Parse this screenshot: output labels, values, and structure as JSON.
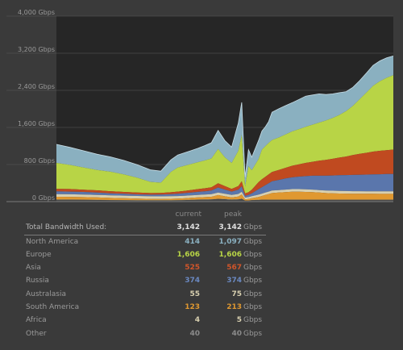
{
  "chart_data": {
    "type": "area",
    "stacked": true,
    "y_unit": "Gbps",
    "ylim": [
      0,
      4000
    ],
    "y_ticks": [
      "0 Gbps",
      "800 Gbps",
      "1,600 Gbps",
      "2,400 Gbps",
      "3,200 Gbps",
      "4,000 Gbps"
    ],
    "y_tick_values": [
      0,
      800,
      1600,
      2400,
      3200,
      4000
    ],
    "grid": true,
    "x": [
      0,
      4,
      8,
      12,
      16,
      20,
      24,
      28,
      31,
      34,
      36,
      38,
      40,
      42,
      44,
      46,
      48,
      50,
      52,
      54,
      55,
      56,
      57,
      58,
      60,
      61,
      62,
      63,
      64,
      66,
      68,
      70,
      72,
      74,
      76,
      78,
      80,
      82,
      84,
      86,
      88,
      90,
      92,
      94,
      96,
      98,
      100
    ],
    "series": [
      {
        "color": "#4a4a4a",
        "values": [
          40,
          40,
          38,
          35,
          30,
          28,
          26,
          24,
          25,
          26,
          28,
          32,
          36,
          40,
          42,
          45,
          55,
          50,
          40,
          45,
          60,
          20,
          22,
          30,
          35,
          38,
          38,
          40,
          40,
          40,
          40,
          40,
          40,
          40,
          40,
          40,
          40,
          40,
          40,
          40,
          40,
          40,
          40,
          40,
          40,
          40,
          40
        ]
      },
      {
        "color": "#c8c29c",
        "values": [
          5,
          5,
          5,
          5,
          5,
          5,
          5,
          5,
          5,
          5,
          5,
          5,
          5,
          5,
          5,
          5,
          5,
          5,
          5,
          5,
          5,
          2,
          3,
          3,
          4,
          4,
          4,
          4,
          4,
          4,
          4,
          4,
          4,
          4,
          4,
          4,
          4,
          4,
          4,
          4,
          4,
          4,
          4,
          4,
          4,
          4,
          4
        ]
      },
      {
        "color": "#e09830",
        "values": [
          60,
          58,
          55,
          50,
          45,
          40,
          35,
          30,
          28,
          30,
          32,
          35,
          40,
          45,
          50,
          55,
          80,
          60,
          45,
          60,
          90,
          25,
          30,
          40,
          60,
          80,
          100,
          120,
          140,
          150,
          160,
          170,
          170,
          165,
          160,
          150,
          140,
          135,
          130,
          128,
          126,
          125,
          124,
          124,
          123,
          123,
          123
        ]
      },
      {
        "color": "#d8d0b0",
        "values": [
          55,
          55,
          55,
          55,
          55,
          55,
          55,
          55,
          55,
          55,
          55,
          55,
          55,
          55,
          55,
          55,
          55,
          55,
          55,
          55,
          55,
          40,
          42,
          45,
          50,
          50,
          52,
          52,
          54,
          54,
          55,
          55,
          55,
          55,
          55,
          55,
          55,
          55,
          55,
          55,
          55,
          55,
          55,
          55,
          55,
          55,
          55
        ]
      },
      {
        "color": "#5a76ac",
        "values": [
          60,
          58,
          55,
          50,
          45,
          40,
          35,
          35,
          40,
          45,
          50,
          55,
          60,
          65,
          70,
          80,
          110,
          90,
          70,
          90,
          120,
          40,
          45,
          60,
          120,
          140,
          160,
          180,
          200,
          220,
          240,
          255,
          270,
          285,
          300,
          310,
          320,
          330,
          340,
          345,
          350,
          355,
          360,
          365,
          368,
          372,
          374
        ]
      },
      {
        "color": "#c04a20",
        "values": [
          55,
          55,
          50,
          48,
          45,
          40,
          38,
          35,
          35,
          40,
          45,
          50,
          55,
          60,
          65,
          70,
          90,
          75,
          60,
          80,
          110,
          50,
          60,
          80,
          150,
          170,
          180,
          190,
          200,
          215,
          230,
          250,
          265,
          285,
          300,
          325,
          340,
          360,
          380,
          400,
          430,
          450,
          470,
          490,
          505,
          515,
          525
        ]
      },
      {
        "color": "#b8d446",
        "values": [
          560,
          520,
          480,
          440,
          420,
          380,
          320,
          240,
          220,
          440,
          520,
          540,
          560,
          580,
          600,
          620,
          740,
          620,
          560,
          760,
          1000,
          150,
          560,
          420,
          500,
          640,
          660,
          680,
          690,
          700,
          720,
          740,
          760,
          780,
          800,
          820,
          850,
          880,
          920,
          980,
          1060,
          1180,
          1300,
          1420,
          1500,
          1560,
          1606
        ]
      },
      {
        "color": "#8ab0c0",
        "values": [
          400,
          380,
          360,
          340,
          320,
          300,
          280,
          260,
          250,
          260,
          270,
          280,
          290,
          300,
          320,
          340,
          400,
          360,
          340,
          600,
          700,
          200,
          360,
          280,
          400,
          400,
          420,
          460,
          600,
          620,
          620,
          620,
          640,
          660,
          640,
          620,
          560,
          520,
          480,
          420,
          400,
          400,
          420,
          440,
          440,
          430,
          414
        ]
      }
    ]
  },
  "table": {
    "headers": {
      "current": "current",
      "peak": "peak"
    },
    "rows": [
      {
        "label": "Total Bandwidth Used:",
        "current": "3,142",
        "peak": "3,142",
        "unit": "Gbps",
        "color": "#e0e0e0",
        "total": true
      },
      {
        "label": "North America",
        "current": "414",
        "peak": "1,097",
        "unit": "Gbps",
        "color": "#8ab0c0"
      },
      {
        "label": "Europe",
        "current": "1,606",
        "peak": "1,606",
        "unit": "Gbps",
        "color": "#b8d446"
      },
      {
        "label": "Asia",
        "current": "525",
        "peak": "567",
        "unit": "Gbps",
        "color": "#d0552a"
      },
      {
        "label": "Russia",
        "current": "374",
        "peak": "374",
        "unit": "Gbps",
        "color": "#6a88c0"
      },
      {
        "label": "Australasia",
        "current": "55",
        "peak": "75",
        "unit": "Gbps",
        "color": "#d8d0b0"
      },
      {
        "label": "South America",
        "current": "123",
        "peak": "213",
        "unit": "Gbps",
        "color": "#e09830"
      },
      {
        "label": "Africa",
        "current": "4",
        "peak": "5",
        "unit": "Gbps",
        "color": "#d8d0b0"
      },
      {
        "label": "Other",
        "current": "40",
        "peak": "40",
        "unit": "Gbps",
        "color": "#8a8a8a"
      }
    ]
  }
}
